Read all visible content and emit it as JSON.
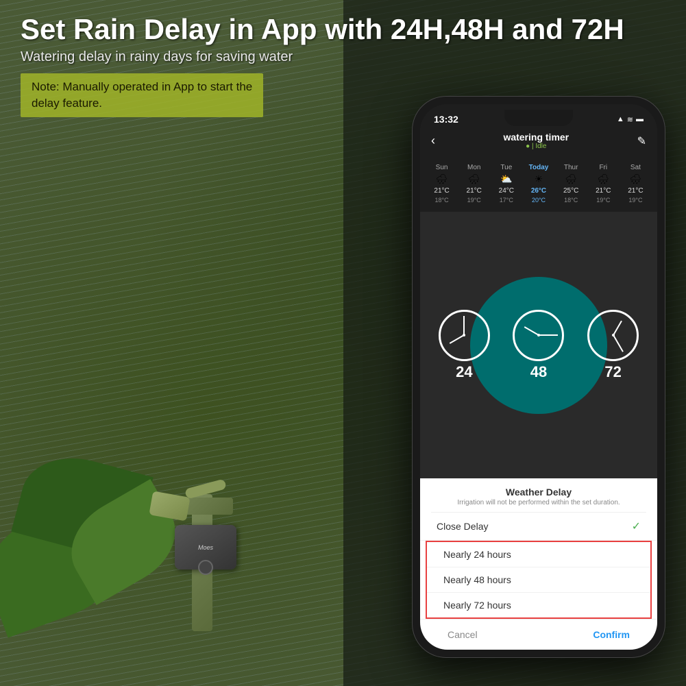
{
  "header": {
    "main_title": "Set Rain Delay in App with 24H,48H and 72H",
    "subtitle": "Watering delay in rainy days for saving water",
    "note_label": "Note: Manually operated in App to start the\ndelay feature."
  },
  "phone": {
    "status_bar": {
      "time": "13:32",
      "signal_icon": "▲",
      "wifi_icon": "▲",
      "battery_icon": "▬"
    },
    "app_title": "watering timer",
    "app_status": "● | Idle",
    "back_label": "‹",
    "edit_label": "✎",
    "days": [
      {
        "label": "Sun",
        "icon": "🌧",
        "high": "21°C",
        "low": "18°C",
        "today": false
      },
      {
        "label": "Mon",
        "icon": "🌧",
        "high": "21°C",
        "low": "19°C",
        "today": false
      },
      {
        "label": "Tue",
        "icon": "🌤",
        "high": "24°C",
        "low": "17°C",
        "today": false
      },
      {
        "label": "Today",
        "icon": "☀",
        "high": "26°C",
        "low": "20°C",
        "today": true
      },
      {
        "label": "Thur",
        "icon": "🌧",
        "high": "25°C",
        "low": "18°C",
        "today": false
      },
      {
        "label": "Fri",
        "icon": "🌧",
        "high": "21°C",
        "low": "19°C",
        "today": false
      },
      {
        "label": "Sat",
        "icon": "🌧",
        "high": "21°C",
        "low": "19°C",
        "today": false
      }
    ],
    "clocks": [
      {
        "number": "24"
      },
      {
        "number": "48"
      },
      {
        "number": "72"
      }
    ],
    "modal": {
      "title": "Weather Delay",
      "subtitle": "Irrigation will not be performed within the set duration.",
      "close_delay_label": "Close Delay",
      "check_mark": "✓",
      "options": [
        {
          "label": "Nearly 24 hours"
        },
        {
          "label": "Nearly 48 hours"
        },
        {
          "label": "Nearly 72 hours"
        }
      ],
      "cancel_label": "Cancel",
      "confirm_label": "Confirm"
    }
  },
  "colors": {
    "accent_green": "#8BC34A",
    "teal": "#006d6d",
    "rain_blue": "#64B5F6",
    "red_border": "#e84040",
    "confirm_blue": "#2196F3"
  }
}
